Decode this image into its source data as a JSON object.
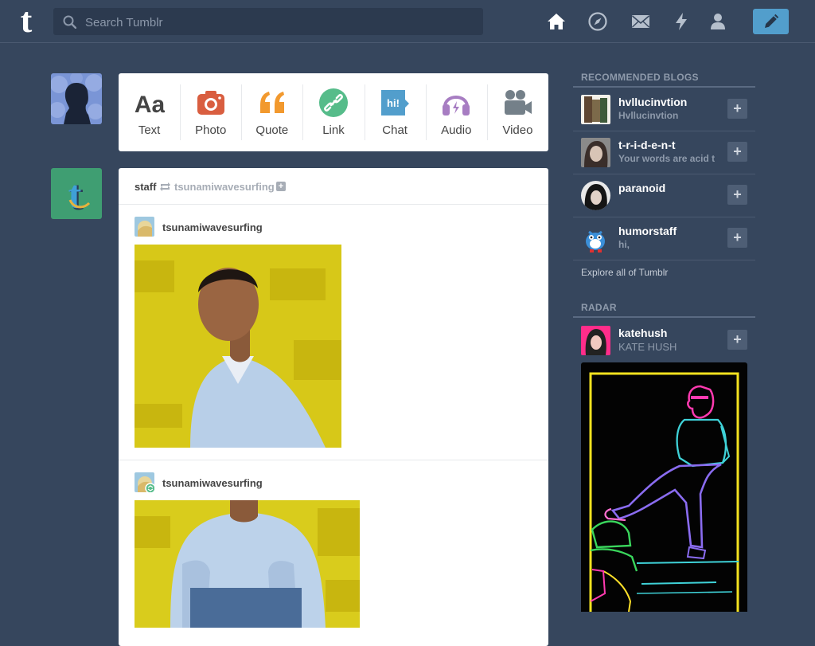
{
  "header": {
    "logo_letter": "t",
    "search_placeholder": "Search Tumblr",
    "nav_icons": [
      "home-icon",
      "explore-compass-icon",
      "inbox-mail-icon",
      "activity-lightning-icon",
      "account-person-icon"
    ],
    "compose_icon": "pencil-icon",
    "accent": "#529ecc",
    "background": "#36465d"
  },
  "post_types": [
    {
      "label": "Text",
      "glyph": "Aa",
      "color": "#444444"
    },
    {
      "label": "Photo",
      "color": "#d95e40"
    },
    {
      "label": "Quote",
      "glyph": "“",
      "color": "#f2992e"
    },
    {
      "label": "Link",
      "color": "#56bc8a"
    },
    {
      "label": "Chat",
      "glyph": "hi!",
      "color": "#529ecc"
    },
    {
      "label": "Audio",
      "color": "#a77dc2"
    },
    {
      "label": "Video",
      "color": "#748089"
    }
  ],
  "post": {
    "poster": "staff",
    "reblogged_from": "tsunamiwavesurfing",
    "follow_symbol": "+",
    "reblog_trail": [
      {
        "user": "tsunamiwavesurfing"
      },
      {
        "user": "tsunamiwavesurfing"
      }
    ]
  },
  "recommended": {
    "title": "RECOMMENDED BLOGS",
    "blogs": [
      {
        "name": "hvllucinvtion",
        "subtitle": "Hvllucinvtion"
      },
      {
        "name": "t-r-i-d-e-n-t",
        "subtitle": "Your words are acid t"
      },
      {
        "name": "paranoid",
        "subtitle": ""
      },
      {
        "name": "humorstaff",
        "subtitle": "hi,"
      }
    ],
    "follow_symbol": "+",
    "explore_link": "Explore all of Tumblr"
  },
  "radar": {
    "title": "RADAR",
    "blog": {
      "name": "katehush",
      "subtitle": "KATE HUSH"
    }
  }
}
